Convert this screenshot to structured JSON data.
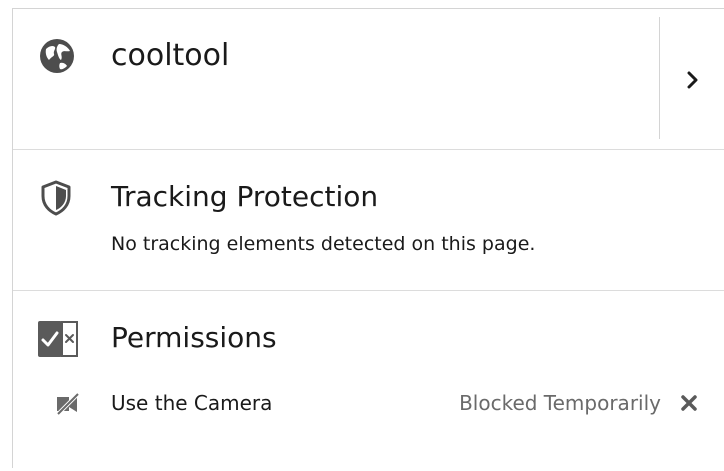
{
  "site": {
    "name": "cooltool",
    "icon": "globe-icon"
  },
  "tracking": {
    "title": "Tracking Protection",
    "description": "No tracking elements detected on this page.",
    "icon": "shield-icon"
  },
  "permissions": {
    "title": "Permissions",
    "icon": "permissions-icon",
    "items": [
      {
        "label": "Use the Camera",
        "state": "Blocked Temporarily",
        "icon": "camera-blocked-icon"
      }
    ]
  },
  "colors": {
    "icon": "#4a4a4a",
    "muted_text": "#6a6a6a",
    "divider": "#dcdcdc"
  }
}
